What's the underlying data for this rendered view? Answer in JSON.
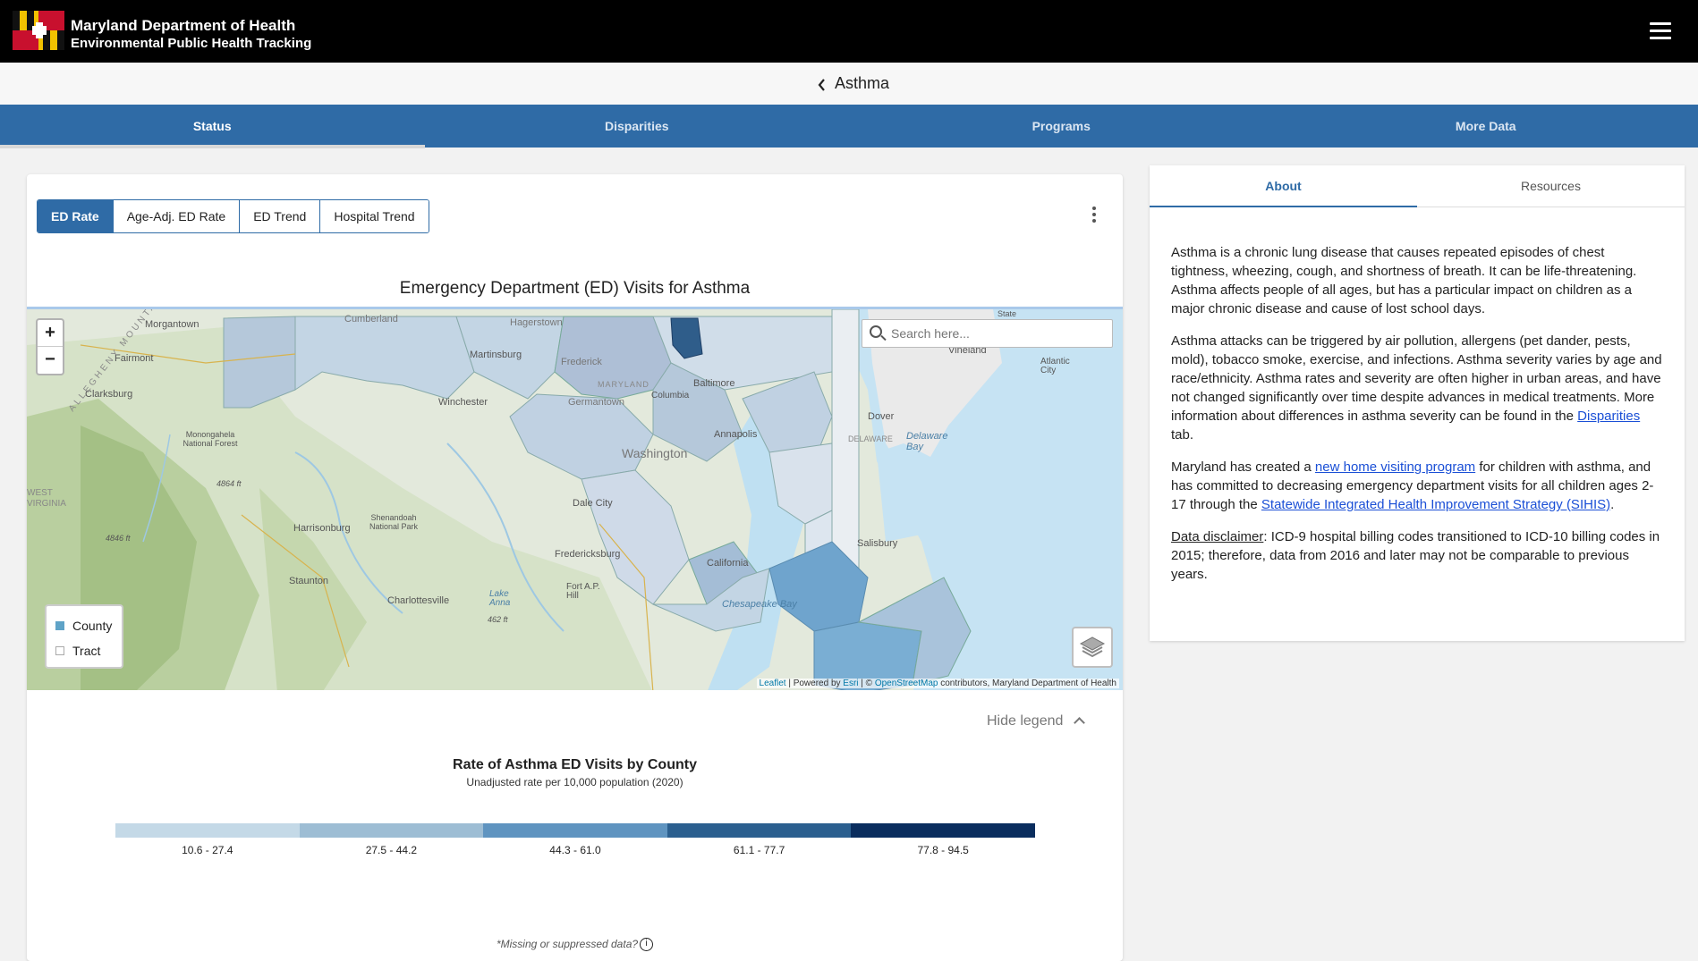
{
  "header": {
    "org_line1": "Maryland Department of Health",
    "org_line2": "Environmental Public Health Tracking",
    "menu_icon": "hamburger-menu-icon"
  },
  "subheader": {
    "back_icon": "chevron-left-icon",
    "title": "Asthma"
  },
  "main_tabs": [
    {
      "label": "Status",
      "active": true
    },
    {
      "label": "Disparities"
    },
    {
      "label": "Programs"
    },
    {
      "label": "More Data"
    }
  ],
  "measure_buttons": [
    {
      "label": "ED Rate",
      "active": true
    },
    {
      "label": "Age-Adj. ED Rate"
    },
    {
      "label": "ED Trend"
    },
    {
      "label": "Hospital Trend"
    }
  ],
  "chart_title": "Emergency Department (ED) Visits for Asthma",
  "map": {
    "zoom_in": "+",
    "zoom_out": "−",
    "search_placeholder": "Search here...",
    "layer_legend": [
      {
        "label": "County",
        "color": "#5fa3c7"
      },
      {
        "label": "Tract",
        "color": "#ffffff"
      }
    ],
    "attribution": {
      "leaflet": "Leaflet",
      "powered": " | Powered by ",
      "esri": "Esri",
      "osm_pre": " | © ",
      "osm": "OpenStreetMap",
      "rest": " contributors, Maryland Department of Health"
    },
    "place_labels": {
      "morgantown": "Morgantown",
      "cumberland": "Cumberland",
      "hagerstown": "Hagerstown",
      "fairmont": "Fairmont",
      "martinsburg": "Martinsburg",
      "frederick": "Frederick",
      "maryland": "MARYLAND",
      "columbia": "Columbia",
      "baltimore": "Baltimore",
      "germantown": "Germantown",
      "clarksburg": "Clarksburg",
      "winchester": "Winchester",
      "annapolis": "Annapolis",
      "washington": "Washington",
      "dover": "Dover",
      "delaware": "DELAWARE",
      "delaware_bay": "Delaware Bay",
      "vineland": "Vineland",
      "atlantic_city": "Atlantic City",
      "state": "State",
      "dale_city": "Dale City",
      "harrisonburg": "Harrisonburg",
      "fredericksburg": "Fredericksburg",
      "california": "California",
      "salisbury": "Salisbury",
      "staunton": "Staunton",
      "charlottesville": "Charlottesville",
      "fort_ap_hill": "Fort A.P. Hill",
      "lake_anna": "Lake Anna",
      "chesapeake_bay": "Chesapeake Bay",
      "west_virginia": "WEST VIRGINIA",
      "monongahela": "Monongahela National Forest",
      "shenandoah": "Shenandoah National Park",
      "allegheny": "ALLEGHENY MOUNTAIN",
      "elev1": "4864 ft",
      "elev2": "4846 ft",
      "elev3": "462 ft"
    }
  },
  "legend_toggle": "Hide legend",
  "legend": {
    "title": "Rate of Asthma ED Visits by County",
    "subtitle": "Unadjusted rate per 10,000 population (2020)",
    "bins": [
      {
        "label": "10.6 - 27.4",
        "color": "#c4d9e7"
      },
      {
        "label": "27.5 - 44.2",
        "color": "#9dbdd4"
      },
      {
        "label": "44.3 - 61.0",
        "color": "#5f94c0"
      },
      {
        "label": "61.1 - 77.7",
        "color": "#2b5f8f"
      },
      {
        "label": "77.8 - 94.5",
        "color": "#0a2d5e"
      }
    ]
  },
  "missing_note": "*Missing or suppressed data?",
  "side_panel": {
    "tabs": [
      {
        "label": "About",
        "active": true
      },
      {
        "label": "Resources"
      }
    ],
    "p1": "Asthma is a chronic lung disease that causes repeated episodes of chest tightness, wheezing, cough, and shortness of breath. It can be life-threatening. Asthma affects people of all ages, but has a particular impact on children as a major chronic disease and cause of lost school days.",
    "p2a": "Asthma attacks can be triggered by air pollution, allergens (pet dander, pests, mold), tobacco smoke, exercise, and infections. Asthma severity varies by age and race/ethnicity. Asthma rates and severity are often higher in urban areas, and have not changed significantly over time despite advances in medical treatments. More information about differences in asthma severity can be found in the ",
    "p2_link": "Disparities",
    "p2b": " tab.",
    "p3a": "Maryland has created a ",
    "p3_link1": "new home visiting program",
    "p3b": " for children with asthma, and has committed to decreasing emergency department visits for all children ages 2-17 through the ",
    "p3_link2": "Statewide Integrated Health Improvement Strategy (SIHIS)",
    "p3c": ".",
    "p4_label": "Data disclaimer",
    "p4": ": ICD-9 hospital billing codes transitioned to ICD-10 billing codes in 2015; therefore, data from 2016 and later may not be comparable to previous years."
  }
}
